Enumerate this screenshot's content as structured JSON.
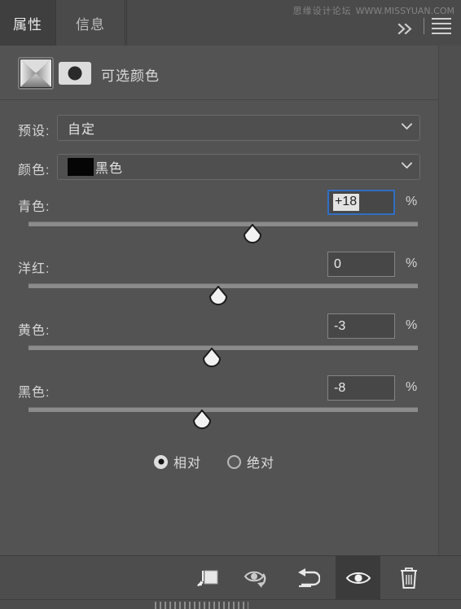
{
  "window": {
    "watermark_cn": "思缘设计论坛",
    "watermark_url": "WWW.MISSYUAN.COM"
  },
  "tabs": [
    {
      "label": "属性",
      "active": true,
      "name": "tab-properties"
    },
    {
      "label": "信息",
      "active": false,
      "name": "tab-info"
    }
  ],
  "tabbar_controls": {
    "collapse_label": "»",
    "menu_icon": "hamburger-menu-icon",
    "expand_icon": "double-chevron-right-icon"
  },
  "adjustment": {
    "title": "可选颜色",
    "layer_thumb_icon": "selective-color-thumbnail",
    "mask_thumb_icon": "layer-mask-thumbnail"
  },
  "fields": {
    "preset": {
      "label": "预设:",
      "value": "自定",
      "caret_icon": "chevron-down-icon"
    },
    "color": {
      "label": "颜色:",
      "value": "黑色",
      "swatch_hex": "#050505",
      "caret_icon": "chevron-down-icon"
    }
  },
  "sliders": [
    {
      "label": "青色:",
      "value": "+18",
      "unit": "%",
      "focused": true,
      "thumb_pct": 57.5,
      "name": "cyan"
    },
    {
      "label": "洋红:",
      "value": "0",
      "unit": "%",
      "focused": false,
      "thumb_pct": 48.7,
      "name": "magenta"
    },
    {
      "label": "黄色:",
      "value": "-3",
      "unit": "%",
      "focused": false,
      "thumb_pct": 47.0,
      "name": "yellow"
    },
    {
      "label": "黑色:",
      "value": "-8",
      "unit": "%",
      "focused": false,
      "thumb_pct": 44.4,
      "name": "black"
    }
  ],
  "method": {
    "options": [
      {
        "label": "相对",
        "selected": true,
        "name": "relative"
      },
      {
        "label": "绝对",
        "selected": false,
        "name": "absolute"
      }
    ]
  },
  "toolbar": {
    "buttons": [
      {
        "name": "clip-to-layer-button",
        "icon": "clip-to-layer-icon",
        "active": false
      },
      {
        "name": "view-previous-state-button",
        "icon": "eye-previous-state-icon",
        "active": false
      },
      {
        "name": "reset-button",
        "icon": "reset-arrow-icon",
        "active": false
      },
      {
        "name": "toggle-visibility-button",
        "icon": "eye-icon",
        "active": true
      },
      {
        "name": "delete-layer-button",
        "icon": "trash-icon",
        "active": false
      }
    ]
  },
  "colors": {
    "panel_bg": "#535353",
    "tabbar_bg": "#4a4a4a",
    "active_tab_bg": "#3f3f3f",
    "focus_ring": "#2f6ec4",
    "track": "#8b8b8b",
    "toolbar_bg": "#4d4d4d"
  }
}
